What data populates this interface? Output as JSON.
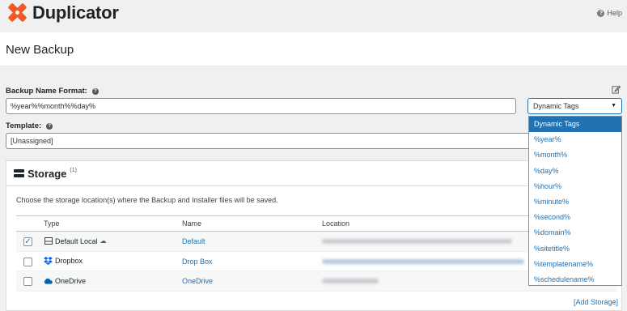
{
  "brand": {
    "name": "Duplicator",
    "logo_color": "#f15a24"
  },
  "header": {
    "help_label": "Help"
  },
  "page": {
    "title": "New Backup"
  },
  "form": {
    "name_format_label": "Backup Name Format:",
    "name_format_value": "%year%%month%%day%",
    "template_label": "Template:",
    "template_value": "[Unassigned]"
  },
  "dynamic_tags": {
    "selected": "Dynamic Tags",
    "options": [
      "Dynamic Tags",
      "%year%",
      "%month%",
      "%day%",
      "%hour%",
      "%minute%",
      "%second%",
      "%domain%",
      "%sitetitle%",
      "%templatename%",
      "%schedulename%"
    ]
  },
  "storage": {
    "title": "Storage",
    "count": "(1)",
    "description": "Choose the storage location(s) where the Backup and Installer files will be saved.",
    "columns": {
      "type": "Type",
      "name": "Name",
      "location": "Location"
    },
    "rows": [
      {
        "checked": true,
        "type": "Default Local",
        "icon": "server-icon",
        "name": "Default"
      },
      {
        "checked": false,
        "type": "Dropbox",
        "icon": "dropbox-icon",
        "name": "Drop Box"
      },
      {
        "checked": false,
        "type": "OneDrive",
        "icon": "onedrive-icon",
        "name": "OneDrive"
      }
    ],
    "add_label": "[Add Storage]"
  },
  "colors": {
    "accent": "#2271b1",
    "text": "#1d2327",
    "background": "#f0f0f1"
  }
}
